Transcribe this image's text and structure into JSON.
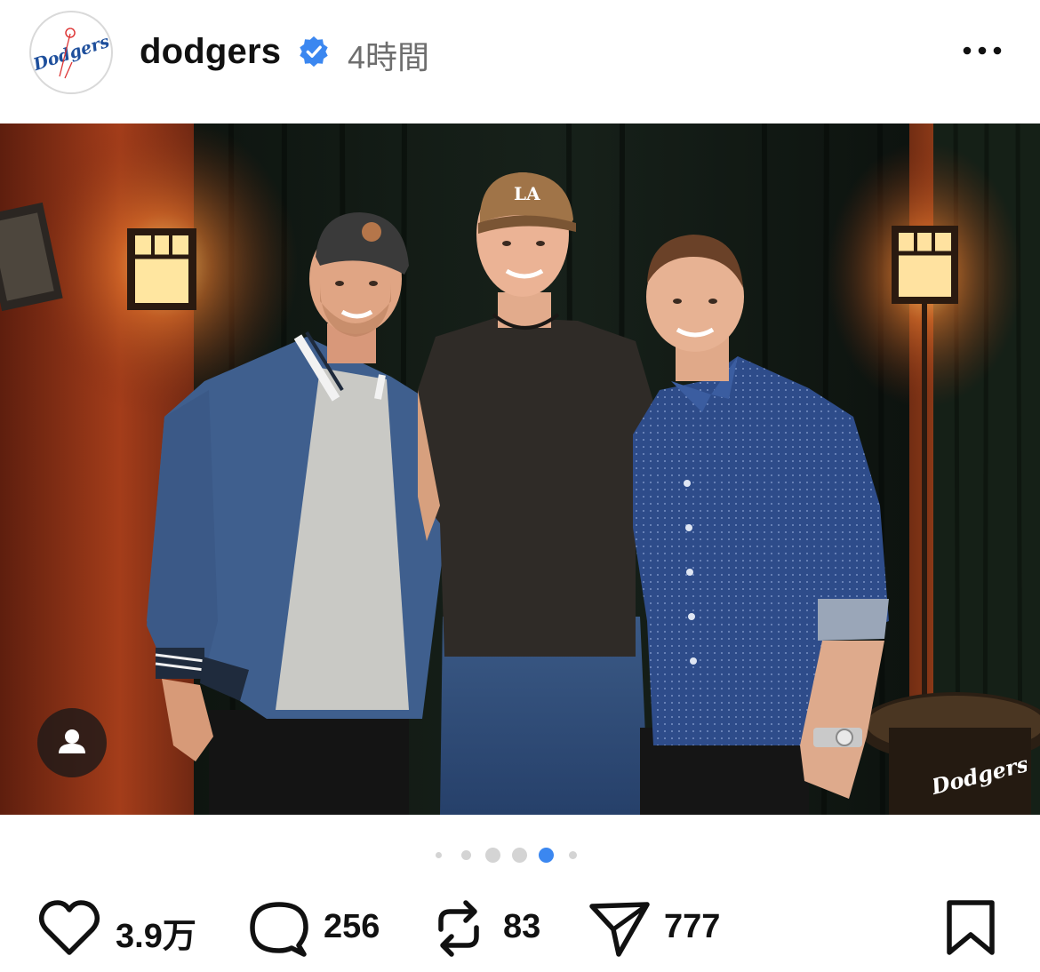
{
  "post": {
    "username": "dodgers",
    "time_ago": "4時間",
    "verified": true,
    "more_icon": "more-horizontal-icon"
  },
  "photo": {
    "description_icon": "person-tag-icon",
    "watermark_text": "Dodgers"
  },
  "carousel": {
    "total_dots": 6,
    "active_index": 4
  },
  "actions": {
    "likes": "3.9万",
    "comments": "256",
    "reposts": "83",
    "shares": "777"
  },
  "colors": {
    "accent": "#3b87f0",
    "dodger_blue": "#1e4f9c",
    "muted_text": "#6e6e6e"
  }
}
